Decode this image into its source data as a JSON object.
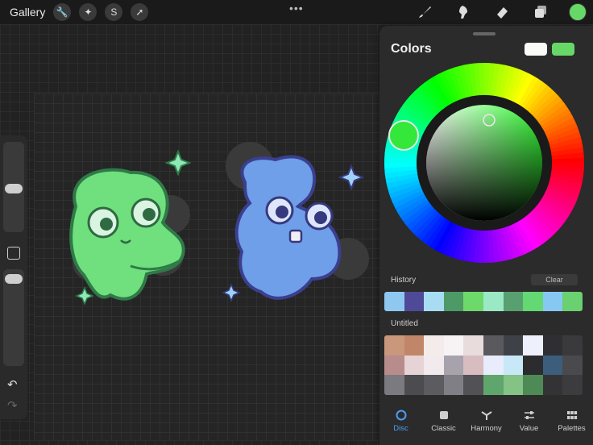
{
  "topbar": {
    "gallery_label": "Gallery",
    "more_glyph": "•••",
    "left_tools": [
      {
        "icon": "wrench-icon",
        "glyph": "🔧"
      },
      {
        "icon": "magic-wand-icon",
        "glyph": "✦"
      },
      {
        "icon": "selection-icon",
        "glyph": "S"
      },
      {
        "icon": "transform-arrow-icon",
        "glyph": "➚"
      }
    ],
    "right_tools": [
      "brush-icon",
      "smudge-icon",
      "eraser-icon",
      "layers-icon"
    ],
    "current_color": "#67d867"
  },
  "sidebar": {
    "undo_glyph": "↶",
    "redo_glyph": "↷"
  },
  "colors_panel": {
    "title": "Colors",
    "previous_color": "#fafaf6",
    "current_color": "#67d867",
    "history_label": "History",
    "clear_label": "Clear",
    "history": [
      "#8ec8f0",
      "#4e4a98",
      "#a7dcf2",
      "#4e9a66",
      "#6dd96b",
      "#9ae8c4",
      "#58a070",
      "#63d873",
      "#86c8f2",
      "#6ad070"
    ],
    "palette_label": "Untitled",
    "palette": [
      "#c9977b",
      "#c1866a",
      "#f3ecea",
      "#f7f3f4",
      "#e8dcdd",
      "#5a5a5e",
      "#3f4148",
      "#eef0fb",
      "#2f2f33",
      "#3a3a3d",
      "#b98c8c",
      "#e6d3d5",
      "#f2eaec",
      "#a7a2ab",
      "#d7bcc0",
      "#e8ecfb",
      "#c8e8f8",
      "#2c2c2e",
      "#3d5d7c",
      "#4a4a4e",
      "#7a7a80",
      "#4c4c50",
      "#5b5b60",
      "#7f7f85",
      "#515156",
      "#5fa66c",
      "#84c285",
      "#4e8a56",
      "#333335",
      "#3c3c3f"
    ],
    "tabs": [
      {
        "label": "Disc",
        "icon": "disc-icon",
        "active": true
      },
      {
        "label": "Classic",
        "icon": "classic-square-icon",
        "active": false
      },
      {
        "label": "Harmony",
        "icon": "harmony-icon",
        "active": false
      },
      {
        "label": "Value",
        "icon": "value-sliders-icon",
        "active": false
      },
      {
        "label": "Palettes",
        "icon": "palettes-grid-icon",
        "active": false
      }
    ]
  }
}
